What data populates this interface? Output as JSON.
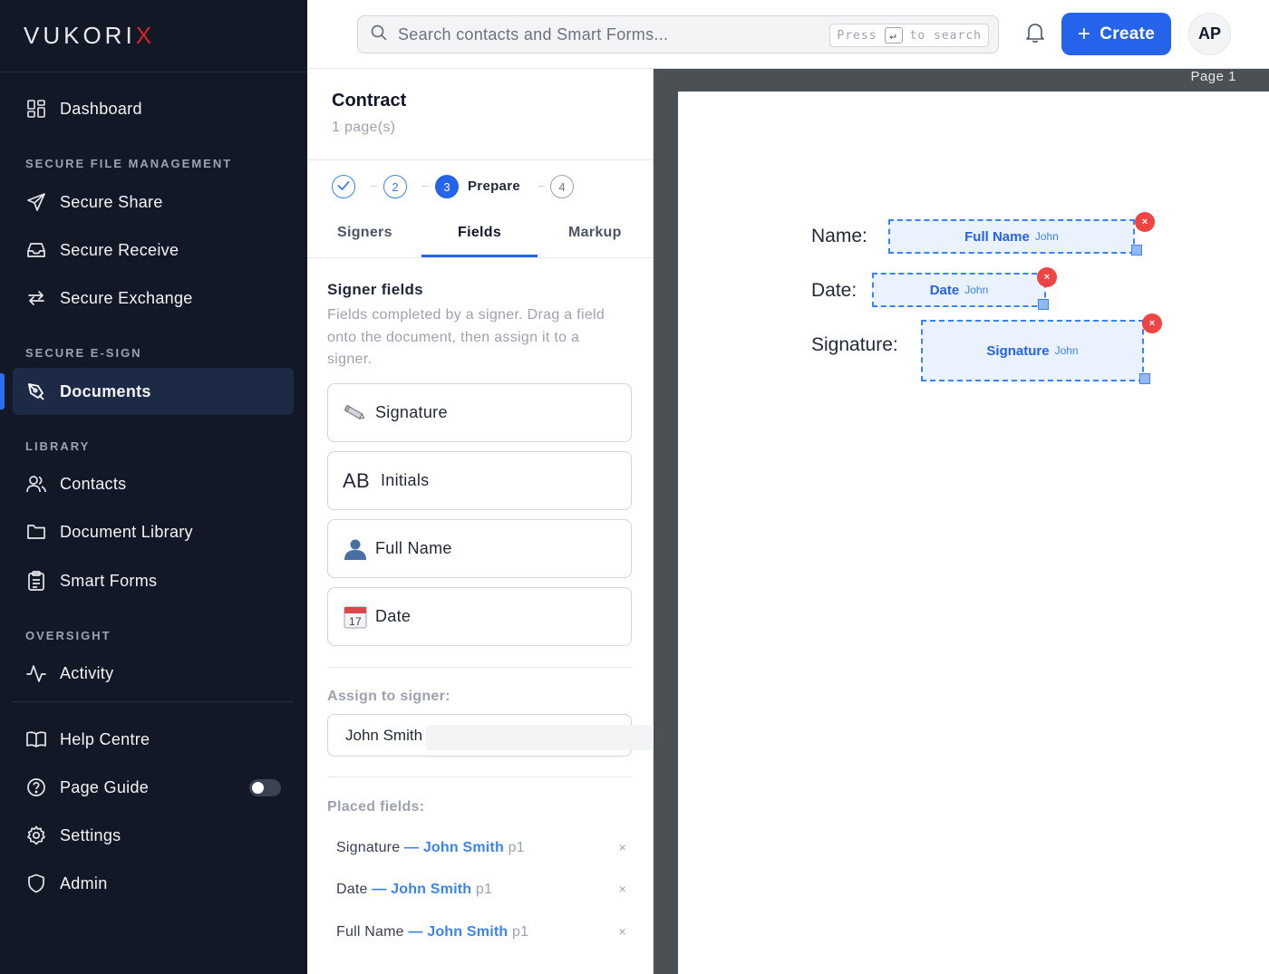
{
  "brand": {
    "logo_main": "VUKORI",
    "logo_x": "X"
  },
  "sidebar": {
    "dashboard": "Dashboard",
    "section_file": "SECURE FILE MANAGEMENT",
    "secure_share": "Secure Share",
    "secure_receive": "Secure Receive",
    "secure_exchange": "Secure Exchange",
    "section_esign": "SECURE E-SIGN",
    "documents": "Documents",
    "section_library": "LIBRARY",
    "contacts": "Contacts",
    "document_library": "Document Library",
    "smart_forms": "Smart Forms",
    "section_oversight": "OVERSIGHT",
    "activity": "Activity",
    "help_centre": "Help Centre",
    "page_guide": "Page Guide",
    "settings": "Settings",
    "admin": "Admin",
    "page_guide_enabled": false
  },
  "topbar": {
    "search_placeholder": "Search contacts and Smart Forms...",
    "kbd_press": "Press",
    "kbd_key": "↵",
    "kbd_to_search": "to search",
    "create_label": "Create",
    "avatar_initials": "AP"
  },
  "panel": {
    "doc_title": "Contract",
    "doc_pages": "1 page(s)",
    "steps": {
      "s2": "2",
      "s3": "3",
      "s3_label": "Prepare",
      "s4": "4"
    },
    "tabs": {
      "signers": "Signers",
      "fields": "Fields",
      "markup": "Markup"
    },
    "signer_fields_title": "Signer fields",
    "signer_fields_desc": "Fields completed by a signer. Drag a field onto the document, then assign it to a signer.",
    "fields": {
      "signature": "Signature",
      "initials_icon": "AB",
      "initials": "Initials",
      "full_name": "Full Name",
      "date_icon": "17",
      "date": "Date"
    },
    "assign_label": "Assign to signer:",
    "assign_value": "John Smith",
    "placed_label": "Placed fields:",
    "placed": [
      {
        "field": "Signature",
        "sep": "—",
        "signer": "John Smith",
        "page": "p1"
      },
      {
        "field": "Date",
        "sep": "—",
        "signer": "John Smith",
        "page": "p1"
      },
      {
        "field": "Full Name",
        "sep": "—",
        "signer": "John Smith",
        "page": "p1"
      }
    ],
    "remove_glyph": "×"
  },
  "viewer": {
    "page_label": "Page 1",
    "labels": {
      "name": "Name:",
      "date": "Date:",
      "signature": "Signature:"
    },
    "boxes": {
      "full_name": {
        "label": "Full Name",
        "signer": "John"
      },
      "date": {
        "label": "Date",
        "signer": "John"
      },
      "signature": {
        "label": "Signature",
        "signer": "John"
      }
    },
    "delete_glyph": "×"
  },
  "colors": {
    "sidebar_bg": "#121826",
    "accent": "#2563eb",
    "active_nav_bg": "#1c2a45",
    "viewer_bg": "#4b5054",
    "delete_red": "#ef4444",
    "logo_x_red": "#d4232b"
  },
  "icons": [
    "dashboard-icon",
    "send-icon",
    "inbox-icon",
    "exchange-icon",
    "pen-icon",
    "users-icon",
    "folder-icon",
    "clipboard-icon",
    "activity-icon",
    "book-icon",
    "help-icon",
    "gear-icon",
    "shield-icon",
    "search-icon",
    "bell-icon",
    "plus-icon",
    "check-icon",
    "pencil-icon",
    "person-icon",
    "calendar-icon"
  ]
}
